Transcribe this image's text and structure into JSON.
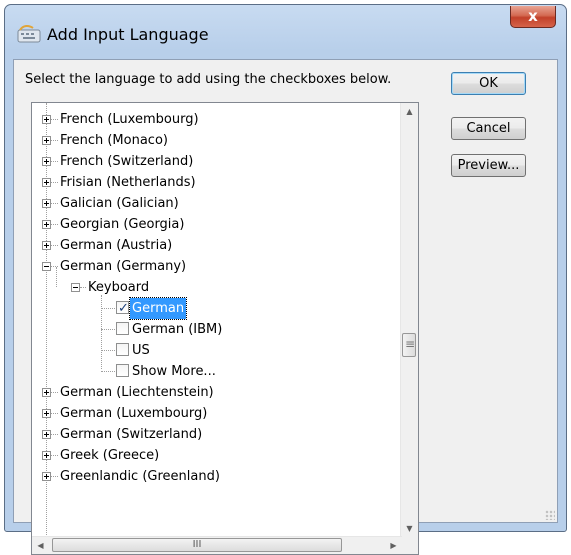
{
  "window": {
    "title": "Add Input Language",
    "close_label": "x"
  },
  "instruction": "Select the language to add using the checkboxes below.",
  "tree": {
    "items_before": [
      "French (Luxembourg)",
      "French (Monaco)",
      "French (Switzerland)",
      "Frisian (Netherlands)",
      "Galician (Galician)",
      "Georgian (Georgia)",
      "German (Austria)"
    ],
    "expanded_item": "German (Germany)",
    "group_label": "Keyboard",
    "keyboards": [
      {
        "label": "German",
        "checked": true,
        "selected": true
      },
      {
        "label": "German (IBM)",
        "checked": false,
        "selected": false
      },
      {
        "label": "US",
        "checked": false,
        "selected": false
      },
      {
        "label": "Show More...",
        "checked": false,
        "selected": false
      }
    ],
    "items_after": [
      "German (Liechtenstein)",
      "German (Luxembourg)",
      "German (Switzerland)",
      "Greek (Greece)",
      "Greenlandic (Greenland)"
    ]
  },
  "buttons": {
    "ok": "OK",
    "cancel": "Cancel",
    "preview": "Preview..."
  },
  "scrollbar": {
    "h_thumb_grip": "III"
  },
  "colors": {
    "selection": "#3399ff",
    "close_button": "#c9452e"
  }
}
